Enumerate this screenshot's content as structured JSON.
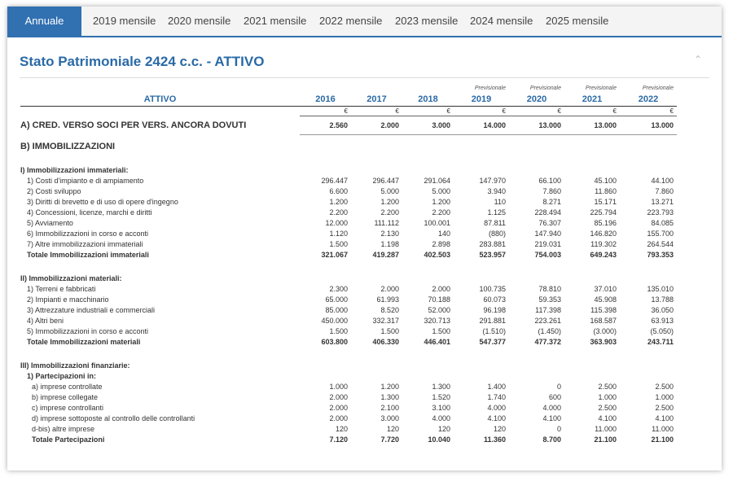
{
  "tabs": [
    "Annuale",
    "2019 mensile",
    "2020 mensile",
    "2021 mensile",
    "2022 mensile",
    "2023 mensile",
    "2024 mensile",
    "2025 mensile"
  ],
  "title": "Stato Patrimoniale 2424 c.c. - ATTIVO",
  "table": {
    "header_label": "ATTIVO",
    "years": [
      "2016",
      "2017",
      "2018",
      "2019",
      "2020",
      "2021",
      "2022"
    ],
    "forecast_label": "Previsionale",
    "currency": "€",
    "section_a": {
      "label": "A) CRED. VERSO SOCI PER VERS. ANCORA DOVUTI",
      "values": [
        "2.560",
        "2.000",
        "3.000",
        "14.000",
        "13.000",
        "13.000",
        "13.000"
      ]
    },
    "section_b": {
      "label": "B) IMMOBILIZZAZIONI"
    },
    "group1": {
      "title": "I) Immobilizzazioni immateriali:",
      "rows": [
        {
          "label": "1) Costi d'impianto e di ampiamento",
          "values": [
            "296.447",
            "296.447",
            "291.064",
            "147.970",
            "66.100",
            "45.100",
            "44.100"
          ]
        },
        {
          "label": "2) Costi sviluppo",
          "values": [
            "6.600",
            "5.000",
            "5.000",
            "3.940",
            "7.860",
            "11.860",
            "7.860"
          ]
        },
        {
          "label": "3) Diritti di brevetto e di uso di opere d'ingegno",
          "values": [
            "1.200",
            "1.200",
            "1.200",
            "110",
            "8.271",
            "15.171",
            "13.271"
          ]
        },
        {
          "label": "4) Concessioni, licenze, marchi e diritti",
          "values": [
            "2.200",
            "2.200",
            "2.200",
            "1.125",
            "228.494",
            "225.794",
            "223.793"
          ]
        },
        {
          "label": "5) Avviamento",
          "values": [
            "12.000",
            "111.112",
            "100.001",
            "87.811",
            "76.307",
            "85.196",
            "84.085"
          ]
        },
        {
          "label": "6) Immobilizzazioni in corso e acconti",
          "values": [
            "1.120",
            "2.130",
            "140",
            "(880)",
            "147.940",
            "146.820",
            "155.700"
          ]
        },
        {
          "label": "7) Altre immobilizzazioni immateriali",
          "values": [
            "1.500",
            "1.198",
            "2.898",
            "283.881",
            "219.031",
            "119.302",
            "264.544"
          ]
        }
      ],
      "total": {
        "label": "Totale Immobilizzazioni immateriali",
        "values": [
          "321.067",
          "419.287",
          "402.503",
          "523.957",
          "754.003",
          "649.243",
          "793.353"
        ]
      }
    },
    "group2": {
      "title": "II) Immobilizzazioni materiali:",
      "rows": [
        {
          "label": "1) Terreni e fabbricati",
          "values": [
            "2.300",
            "2.000",
            "2.000",
            "100.735",
            "78.810",
            "37.010",
            "135.010"
          ]
        },
        {
          "label": "2) Impianti e macchinario",
          "values": [
            "65.000",
            "61.993",
            "70.188",
            "60.073",
            "59.353",
            "45.908",
            "13.788"
          ]
        },
        {
          "label": "3) Attrezzature industriali e commerciali",
          "values": [
            "85.000",
            "8.520",
            "52.000",
            "96.198",
            "117.398",
            "115.398",
            "36.050"
          ]
        },
        {
          "label": "4) Altri beni",
          "values": [
            "450.000",
            "332.317",
            "320.713",
            "291.881",
            "223.261",
            "168.587",
            "63.913"
          ]
        },
        {
          "label": "5) Immobilizzazioni in corso e acconti",
          "values": [
            "1.500",
            "1.500",
            "1.500",
            "(1.510)",
            "(1.450)",
            "(3.000)",
            "(5.050)"
          ]
        }
      ],
      "total": {
        "label": "Totale Immobilizzazioni materiali",
        "values": [
          "603.800",
          "406.330",
          "446.401",
          "547.377",
          "477.372",
          "363.903",
          "243.711"
        ]
      }
    },
    "group3": {
      "title": "III) Immobilizzazioni finanziarie:",
      "subtitle": "1) Partecipazioni in:",
      "rows": [
        {
          "label": "a) imprese controllate",
          "values": [
            "1.000",
            "1.200",
            "1.300",
            "1.400",
            "0",
            "2.500",
            "2.500"
          ]
        },
        {
          "label": "b) imprese collegate",
          "values": [
            "2.000",
            "1.300",
            "1.520",
            "1.740",
            "600",
            "1.000",
            "1.000"
          ]
        },
        {
          "label": "c) imprese controllanti",
          "values": [
            "2.000",
            "2.100",
            "3.100",
            "4.000",
            "4.000",
            "2.500",
            "2.500"
          ]
        },
        {
          "label": "d) imprese sottoposte al controllo delle controllanti",
          "values": [
            "2.000",
            "3.000",
            "4.000",
            "4.100",
            "4.100",
            "4.100",
            "4.100"
          ]
        },
        {
          "label": "d-bis) altre imprese",
          "values": [
            "120",
            "120",
            "120",
            "120",
            "0",
            "11.000",
            "11.000"
          ]
        }
      ],
      "total": {
        "label": "Totale Partecipazioni",
        "values": [
          "7.120",
          "7.720",
          "10.040",
          "11.360",
          "8.700",
          "21.100",
          "21.100"
        ]
      }
    }
  }
}
